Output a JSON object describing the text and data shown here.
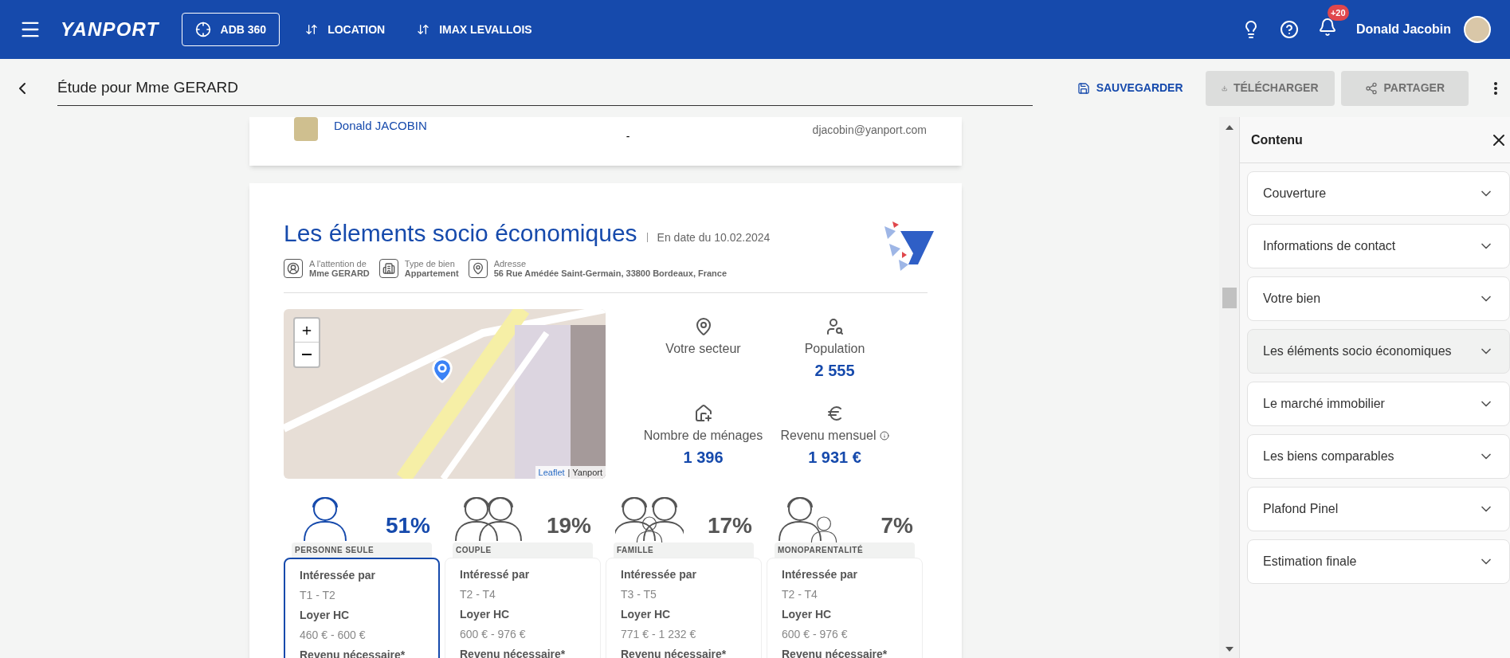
{
  "topbar": {
    "logo": "YANPORT",
    "buttons": [
      {
        "kind": "outlined",
        "label": "ADB 360"
      },
      {
        "kind": "switch",
        "label": "LOCATION"
      },
      {
        "kind": "switch",
        "label": "IMAX LEVALLOIS"
      }
    ],
    "notifications": "+20",
    "user": "Donald Jacobin"
  },
  "toolbar": {
    "title": "Étude pour Mme GERARD",
    "actions": [
      {
        "label": "SAUVEGARDER",
        "kind": "save",
        "disabled": false
      },
      {
        "label": "TÉLÉCHARGER",
        "kind": "download",
        "disabled": true
      },
      {
        "label": "PARTAGER",
        "kind": "share",
        "disabled": true
      }
    ]
  },
  "contact_card": {
    "name": "Donald JACOBIN",
    "dash": "-",
    "email": "djacobin@yanport.com"
  },
  "section": {
    "title": "Les élements socio économiques",
    "date": "En date du 10.02.2024",
    "info": [
      {
        "kind": "person",
        "label": "A l'attention de",
        "value": "Mme GERARD"
      },
      {
        "kind": "building",
        "label": "Type de bien",
        "value": "Appartement"
      },
      {
        "kind": "pin",
        "label": "Adresse",
        "value": "56 Rue Amédée Saint-Germain, 33800 Bordeaux, France"
      }
    ],
    "map": {
      "attribution_link": "Leaflet",
      "attribution_text": "| Yanport"
    },
    "stats": [
      {
        "kind": "pin",
        "label": "Votre secteur",
        "info": false
      },
      {
        "kind": "population",
        "label": "Population",
        "value": "2 555",
        "info": false
      },
      {
        "kind": "households",
        "label": "Nombre de ménages",
        "value": "1 396",
        "info": false
      },
      {
        "kind": "euro",
        "label": "Revenu mensuel",
        "value": "1 931 €",
        "info": true
      }
    ],
    "households": [
      {
        "kind": "single",
        "percent": "51%",
        "label": "PERSONNE SEULE",
        "selected": true,
        "rows": [
          {
            "label": "Intéressée par",
            "value": "T1 - T2"
          },
          {
            "label": "Loyer HC",
            "value": "460 € - 600 €"
          },
          {
            "label": "Revenu nécessaire*"
          }
        ]
      },
      {
        "kind": "couple",
        "percent": "19%",
        "label": "COUPLE",
        "selected": false,
        "rows": [
          {
            "label": "Intéressé par",
            "value": "T2 - T4"
          },
          {
            "label": "Loyer HC",
            "value": "600 € - 976 €"
          },
          {
            "label": "Revenu nécessaire*"
          }
        ]
      },
      {
        "kind": "family",
        "percent": "17%",
        "label": "FAMILLE",
        "selected": false,
        "rows": [
          {
            "label": "Intéressée par",
            "value": "T3 - T5"
          },
          {
            "label": "Loyer HC",
            "value": "771 € - 1 232 €"
          },
          {
            "label": "Revenu nécessaire*"
          }
        ]
      },
      {
        "kind": "single_parent",
        "percent": "7%",
        "label": "MONOPARENTALITÉ",
        "selected": false,
        "rows": [
          {
            "label": "Intéressée par",
            "value": "T2 - T4"
          },
          {
            "label": "Loyer HC",
            "value": "600 € - 976 €"
          },
          {
            "label": "Revenu nécessaire*"
          }
        ]
      }
    ]
  },
  "panel": {
    "title": "Contenu",
    "items": [
      {
        "label": "Couverture",
        "selected": false
      },
      {
        "label": "Informations de contact",
        "selected": false
      },
      {
        "label": "Votre bien",
        "selected": false
      },
      {
        "label": "Les éléments socio économiques",
        "selected": true
      },
      {
        "label": "Le marché immobilier",
        "selected": false
      },
      {
        "label": "Les biens comparables",
        "selected": false
      },
      {
        "label": "Plafond Pinel",
        "selected": false
      },
      {
        "label": "Estimation finale",
        "selected": false
      }
    ]
  }
}
